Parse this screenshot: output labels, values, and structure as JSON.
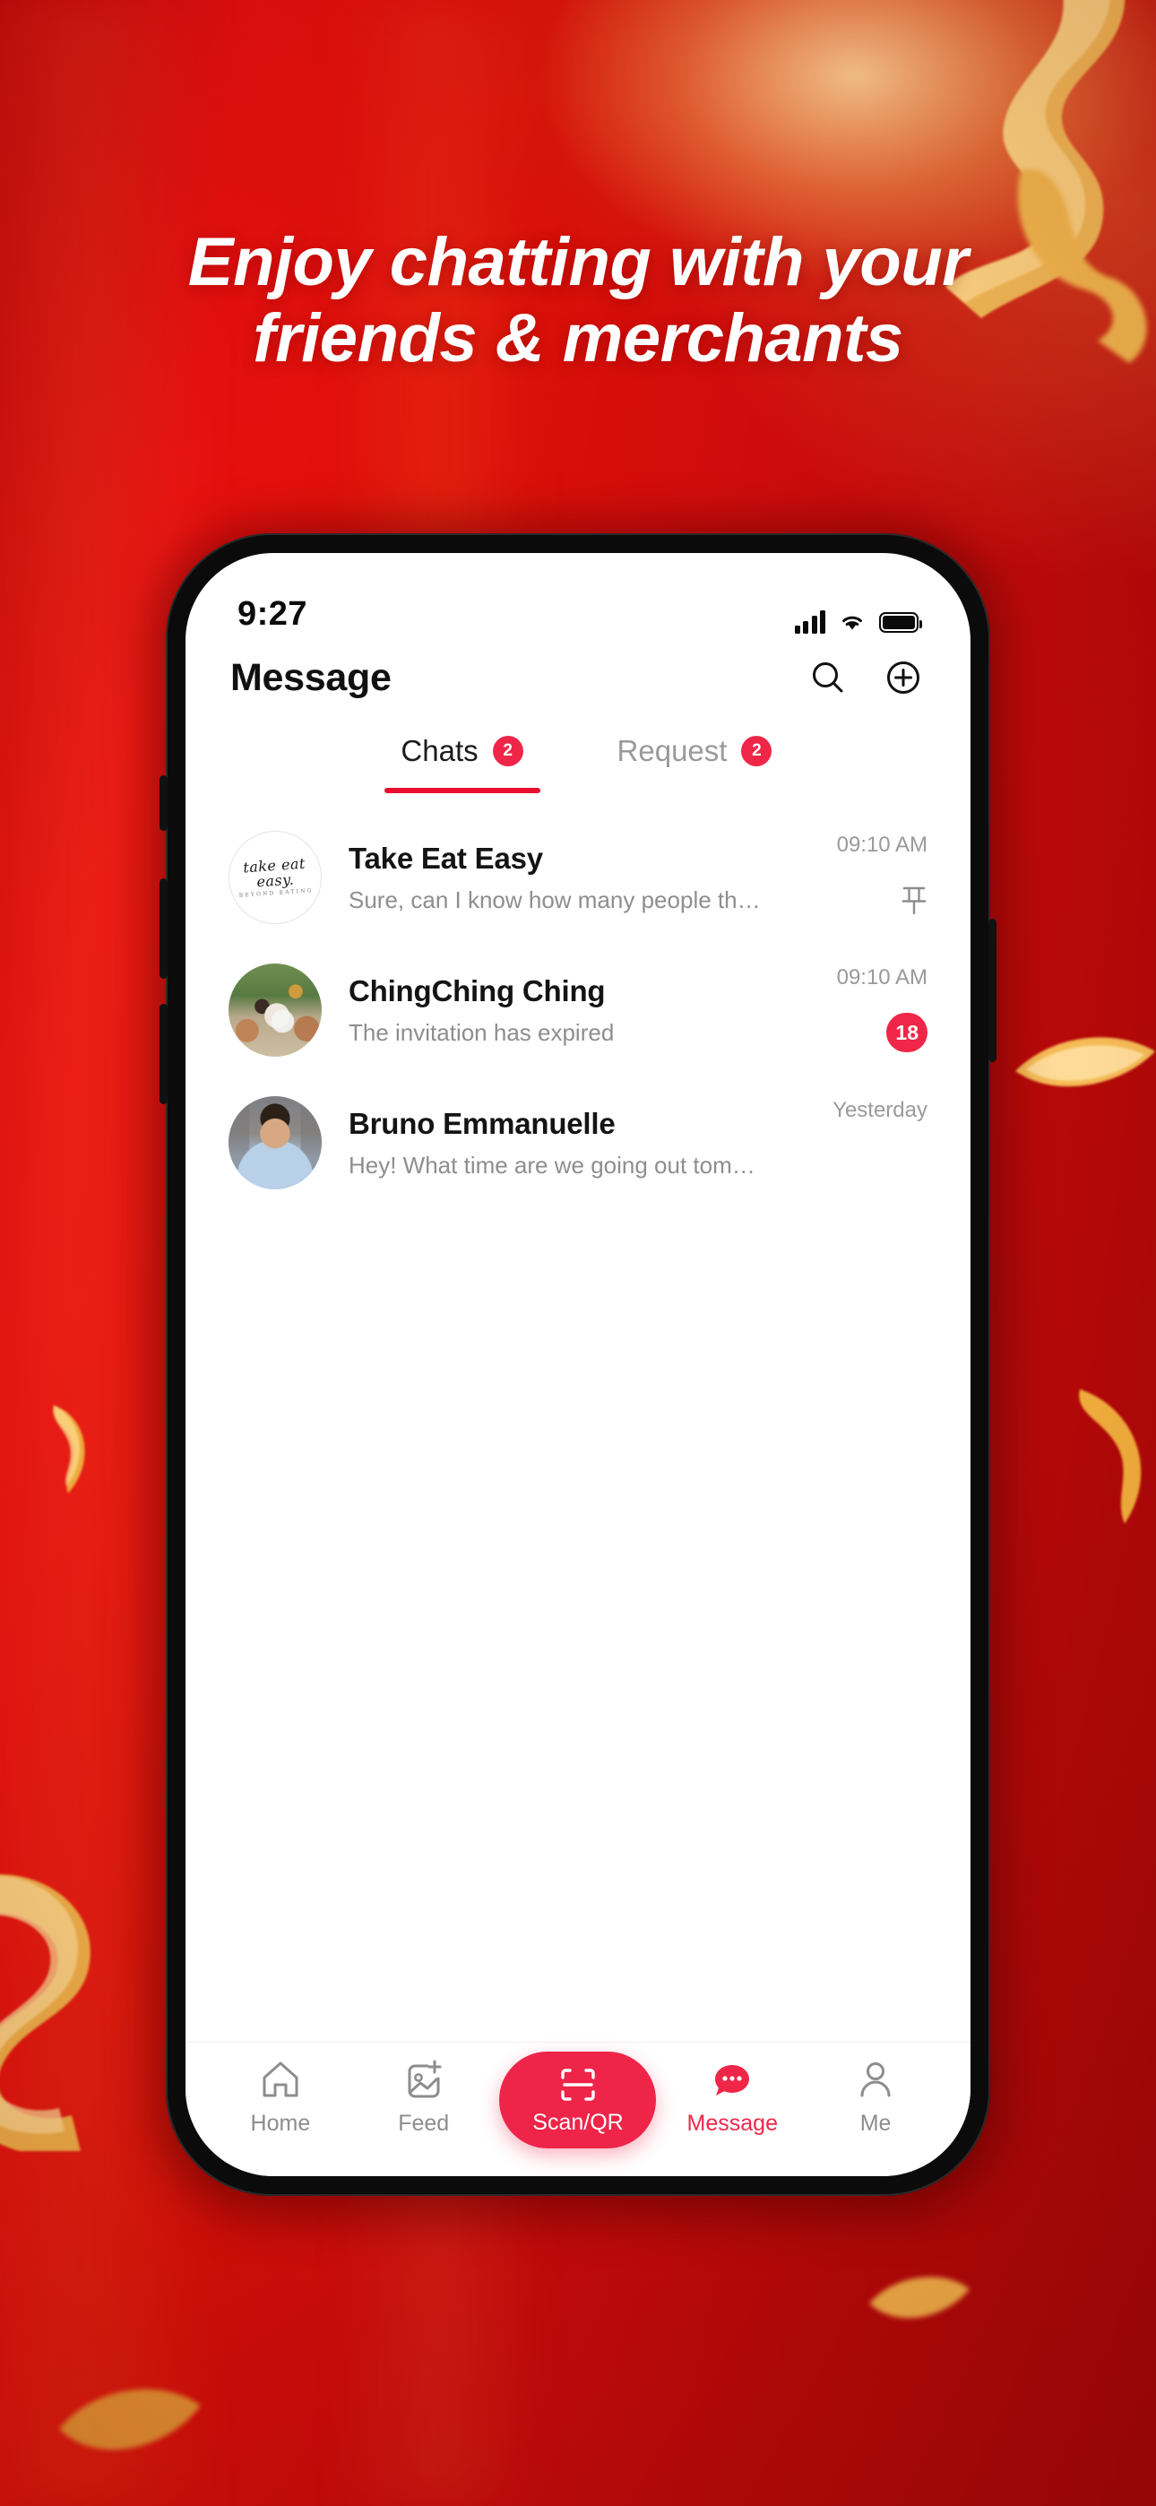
{
  "headline": {
    "line1": "Enjoy chatting with your",
    "line2": "friends & merchants"
  },
  "colors": {
    "background_red": "#d00b0b",
    "accent_red": "#ef2648",
    "tab_underline_red": "#e8102e",
    "gold": "#f0b44a"
  },
  "phone": {
    "status_bar": {
      "time": "9:27",
      "signal_icon": "cellular-signal-icon",
      "wifi_icon": "wifi-icon",
      "battery_icon": "battery-full-icon"
    },
    "header": {
      "title": "Message",
      "search_icon": "search-icon",
      "add_icon": "plus-circle-icon"
    },
    "tabs": [
      {
        "label": "Chats",
        "badge": "2",
        "active": true
      },
      {
        "label": "Request",
        "badge": "2",
        "active": false
      }
    ],
    "chats": [
      {
        "name": "Take Eat Easy",
        "preview": "Sure, can I know how many people there are...",
        "time": "09:10 AM",
        "avatar": "take-eat-easy-logo",
        "avatar_text": "take eat easy.",
        "avatar_subtext": "BEYOND EATING",
        "mark": "pin-icon",
        "badge": ""
      },
      {
        "name": "ChingChing Ching",
        "preview": "The invitation has expired",
        "time": "09:10 AM",
        "avatar": "garden-photo",
        "avatar_text": "",
        "avatar_subtext": "",
        "mark": "unread-badge",
        "badge": "18"
      },
      {
        "name": "Bruno Emmanuelle",
        "preview": "Hey! What time are we going out tomorrow...",
        "time": "Yesterday",
        "avatar": "man-photo",
        "avatar_text": "",
        "avatar_subtext": "",
        "mark": "",
        "badge": ""
      }
    ],
    "bottom_nav": [
      {
        "label": "Home",
        "icon": "home-icon",
        "active": false
      },
      {
        "label": "Feed",
        "icon": "feed-add-icon",
        "active": false
      },
      {
        "label": "Scan/QR",
        "icon": "scan-qr-icon",
        "active": true
      },
      {
        "label": "Message",
        "icon": "message-dots-icon",
        "active": true
      },
      {
        "label": "Me",
        "icon": "person-icon",
        "active": false
      }
    ]
  }
}
